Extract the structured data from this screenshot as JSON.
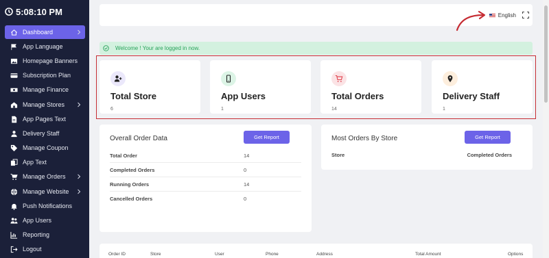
{
  "clock": {
    "time": "5:08:10 PM"
  },
  "sidebar": {
    "items": [
      {
        "label": "Dashboard",
        "icon": "home-icon",
        "chevron": true,
        "active": true
      },
      {
        "label": "App Language",
        "icon": "flag-icon",
        "chevron": false
      },
      {
        "label": "Homepage Banners",
        "icon": "image-icon",
        "chevron": false
      },
      {
        "label": "Subscription Plan",
        "icon": "card-icon",
        "chevron": false
      },
      {
        "label": "Manage Finance",
        "icon": "money-icon",
        "chevron": false
      },
      {
        "label": "Manage Stores",
        "icon": "store-icon",
        "chevron": true
      },
      {
        "label": "App Pages Text",
        "icon": "document-icon",
        "chevron": false
      },
      {
        "label": "Delivery Staff",
        "icon": "user-icon",
        "chevron": false
      },
      {
        "label": "Manage Coupon",
        "icon": "tag-icon",
        "chevron": false
      },
      {
        "label": "App Text",
        "icon": "copy-icon",
        "chevron": false
      },
      {
        "label": "Manage Orders",
        "icon": "cart-icon",
        "chevron": true
      },
      {
        "label": "Manage Website",
        "icon": "globe-icon",
        "chevron": true
      },
      {
        "label": "Push Notifications",
        "icon": "bell-icon",
        "chevron": false
      },
      {
        "label": "App Users",
        "icon": "users-icon",
        "chevron": false
      },
      {
        "label": "Reporting",
        "icon": "chart-icon",
        "chevron": false
      },
      {
        "label": "Logout",
        "icon": "logout-icon",
        "chevron": false
      }
    ]
  },
  "topbar": {
    "language": "English"
  },
  "alert": {
    "message": "Welcome ! Your are logged in now."
  },
  "cards": [
    {
      "title": "Total Store",
      "value": "6",
      "icon": "add-user-icon",
      "icon_bg": "#ebe8fb",
      "icon_color": "#5c4fd8"
    },
    {
      "title": "App Users",
      "value": "1",
      "icon": "mobile-icon",
      "icon_bg": "#dcf4e6",
      "icon_color": "#2aa561"
    },
    {
      "title": "Total Orders",
      "value": "14",
      "icon": "cart-icon",
      "icon_bg": "#fbe3e5",
      "icon_color": "#e0434e"
    },
    {
      "title": "Delivery Staff",
      "value": "1",
      "icon": "map-pin-icon",
      "icon_bg": "#fdeedd",
      "icon_color": "#222222"
    }
  ],
  "overall": {
    "title": "Overall Order Data",
    "button": "Get Report",
    "rows": [
      {
        "label": "Total Order",
        "value": "14"
      },
      {
        "label": "Completed Orders",
        "value": "0"
      },
      {
        "label": "Running Orders",
        "value": "14"
      },
      {
        "label": "Cancelled Orders",
        "value": "0"
      }
    ]
  },
  "most": {
    "title": "Most Orders By Store",
    "button": "Get Report",
    "col_store": "Store",
    "col_completed": "Completed Orders"
  },
  "orders_table": {
    "columns": [
      "Order ID",
      "Store",
      "User",
      "Phone",
      "Address",
      "Total Amount",
      "Options"
    ]
  },
  "colors": {
    "sidebar_bg": "#1b2039",
    "accent": "#6c63e8",
    "highlight_border": "#c62c33",
    "success": "#28a25a"
  }
}
